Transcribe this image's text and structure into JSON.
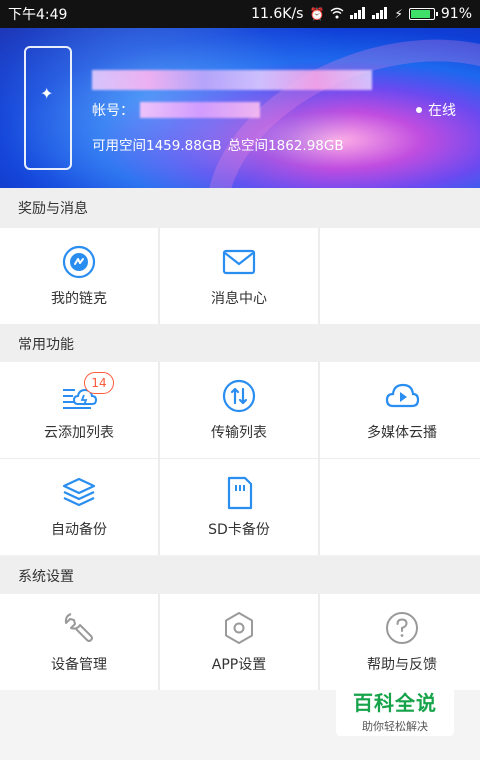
{
  "status_bar": {
    "time": "下午4:49",
    "network_speed": "11.6K/s",
    "battery": "91%",
    "battery_level": 0.91,
    "icons": [
      "alarm-icon",
      "wifi-icon",
      "signal-icon",
      "signal-icon",
      "charging-icon",
      "battery-icon"
    ]
  },
  "profile": {
    "account_label": "帐号：",
    "status": "在线",
    "available_space": "可用空间1459.88GB",
    "total_space": "总空间1862.98GB"
  },
  "sections": {
    "rewards": {
      "title": "奖励与消息",
      "items": [
        {
          "label": "我的链克",
          "icon": "link-coin-icon"
        },
        {
          "label": "消息中心",
          "icon": "mail-icon"
        }
      ]
    },
    "common": {
      "title": "常用功能",
      "items": [
        {
          "label": "云添加列表",
          "icon": "cloud-add-icon",
          "badge": "14"
        },
        {
          "label": "传输列表",
          "icon": "transfer-icon"
        },
        {
          "label": "多媒体云播",
          "icon": "cloud-play-icon"
        },
        {
          "label": "自动备份",
          "icon": "layers-icon"
        },
        {
          "label": "SD卡备份",
          "icon": "sd-card-icon"
        }
      ]
    },
    "settings": {
      "title": "系统设置",
      "items": [
        {
          "label": "设备管理",
          "icon": "wrench-icon"
        },
        {
          "label": "APP设置",
          "icon": "hexagon-settings-icon"
        },
        {
          "label": "帮助与反馈",
          "icon": "help-icon"
        }
      ]
    }
  },
  "watermark": {
    "main": "百科全说",
    "sub": "助你轻松解决"
  },
  "colors": {
    "accent_blue": "#2a8ef0",
    "badge_red": "#ff5a3c",
    "settings_gray": "#9a9a9a",
    "watermark_green": "#16a34a"
  }
}
